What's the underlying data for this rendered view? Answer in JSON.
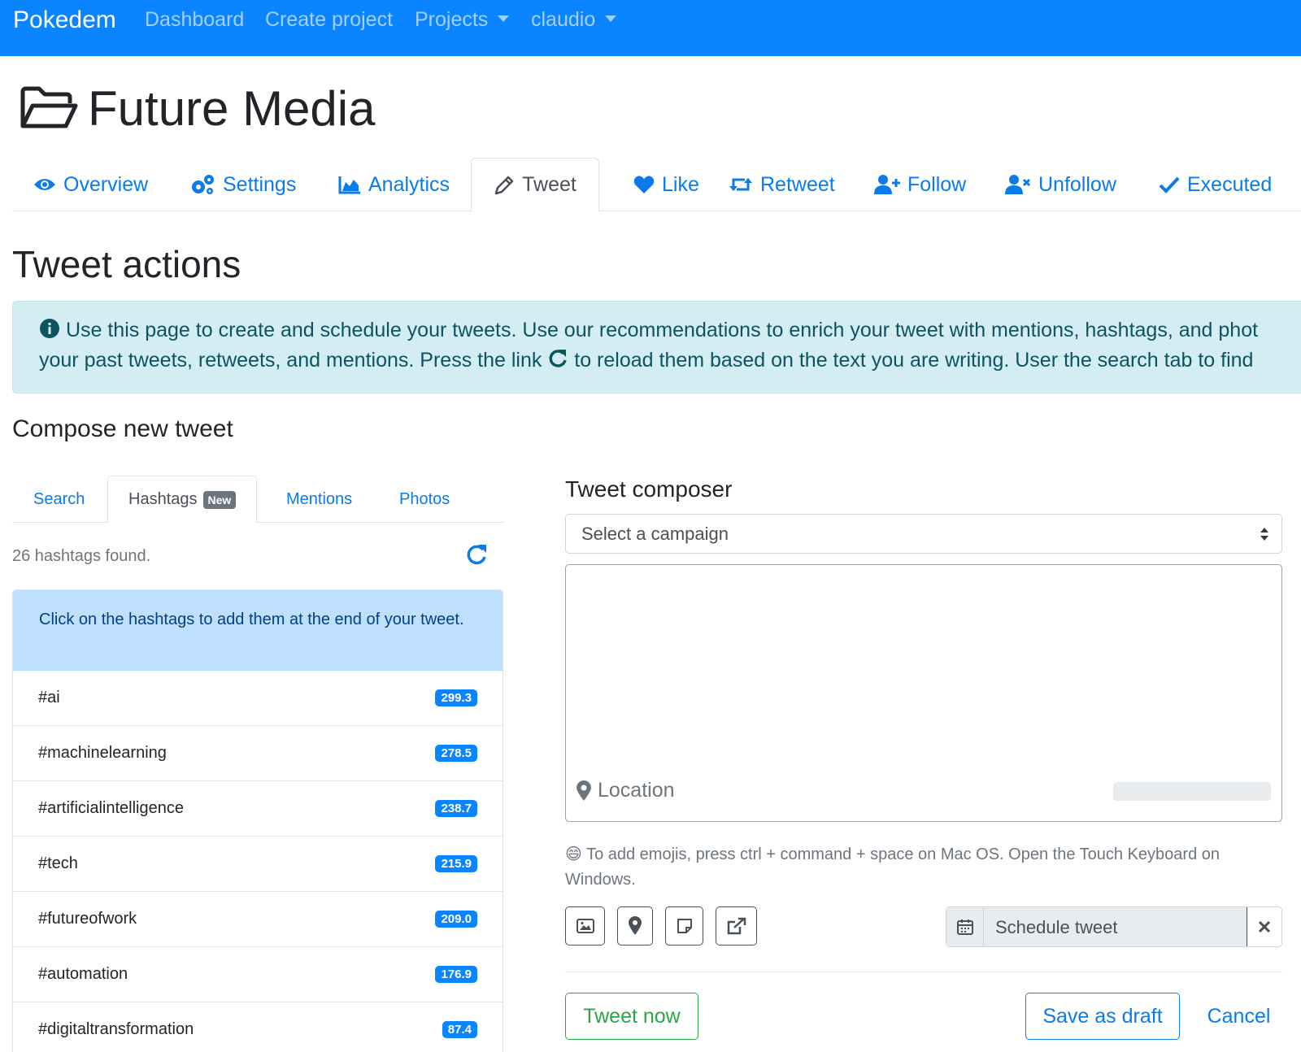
{
  "navbar": {
    "brand": "Pokedem",
    "links": [
      "Dashboard",
      "Create project",
      "Projects",
      "claudio"
    ]
  },
  "project": {
    "title": "Future Media",
    "icon": "folder-open-icon"
  },
  "tabs": [
    {
      "label": "Overview",
      "icon": "eye-icon"
    },
    {
      "label": "Settings",
      "icon": "gears-icon"
    },
    {
      "label": "Analytics",
      "icon": "area-chart-icon"
    },
    {
      "label": "Tweet",
      "icon": "pencil-icon",
      "active": true
    },
    {
      "label": "Like",
      "icon": "heart-icon"
    },
    {
      "label": "Retweet",
      "icon": "retweet-icon"
    },
    {
      "label": "Follow",
      "icon": "user-plus-icon"
    },
    {
      "label": "Unfollow",
      "icon": "user-times-icon"
    },
    {
      "label": "Executed",
      "icon": "check-icon"
    }
  ],
  "page": {
    "title": "Tweet actions",
    "alert_line1": "Use this page to create and schedule your tweets. Use our recommendations to enrich your tweet with mentions, hashtags, and phot",
    "alert_line2a": "your past tweets, retweets, and mentions. Press the link",
    "alert_line2b": "to reload them based on the text you are writing. User the search tab to find",
    "compose_title": "Compose new tweet"
  },
  "subtabs": {
    "search": "Search",
    "hashtags": "Hashtags",
    "new_badge": "New",
    "mentions": "Mentions",
    "photos": "Photos"
  },
  "hashtags": {
    "found_text": "26 hashtags found.",
    "hint": "Click on the hashtags to add them at the end of your tweet.",
    "items": [
      {
        "tag": "#ai",
        "score": "299.3"
      },
      {
        "tag": "#machinelearning",
        "score": "278.5"
      },
      {
        "tag": "#artificialintelligence",
        "score": "238.7"
      },
      {
        "tag": "#tech",
        "score": "215.9"
      },
      {
        "tag": "#futureofwork",
        "score": "209.0"
      },
      {
        "tag": "#automation",
        "score": "176.9"
      },
      {
        "tag": "#digitaltransformation",
        "score": "87.4"
      }
    ]
  },
  "composer": {
    "title": "Tweet composer",
    "campaign_placeholder": "Select a campaign",
    "location_label": "Location",
    "emoji_glyph": "😄",
    "emoji_note": "To add emojis, press ctrl + command + space on Mac OS. Open the Touch Keyboard on Windows.",
    "schedule_placeholder": "Schedule tweet",
    "tweet_now": "Tweet now",
    "save_draft": "Save as draft",
    "cancel": "Cancel"
  },
  "colors": {
    "navbar": "#0a84ff",
    "link": "#0a7be8",
    "success": "#28a745",
    "info_bg": "#d4edf2",
    "list_active_bg": "#bfe0fd"
  }
}
